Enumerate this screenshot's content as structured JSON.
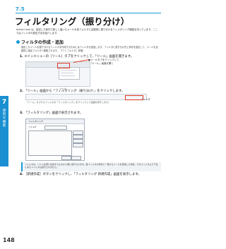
{
  "section": {
    "number": "7.5",
    "title": "フィルタリング（振り分け）"
  },
  "intro": "Active! mail は、指定した条件で新しく届いたメールを各フォルダに自動的に振り分けるフィルタリング機能を持っています。ここではフィルタの設定方法を紹介します。",
  "heading": "フィルタの作成・追加",
  "heading_note": "指定したメールを振り分けるフィルタを作成するためにはフィルタを追加します。フィルタに振り分け先と条件を設定して、メールを自動的に指定フォルダへ移動させます。（「7.1 フォルダ」参照）",
  "side_tab": {
    "number": "7",
    "label": "便利な機能"
  },
  "steps": [
    {
      "num": "1.",
      "text": "メインメニューの［ツール］タブをクリックして、「ツール」画面を開きます。"
    },
    {
      "num": "2.",
      "text": "「ツール」画面から「フィルタリング（振り分け）」をクリックします。"
    },
    {
      "num": "3.",
      "text": "「フィルタリング」画面が表示されます。"
    },
    {
      "num": "4.",
      "text": "［新規作成］ボタンをクリックし、「フィルタリング 新規作成」画面を表示します。"
    }
  ],
  "callouts": {
    "tools_tab": "●ツールタブをクリックして\n　「ツール」画面を開く",
    "tools_label": "ツール",
    "filter_label": "フィルタ"
  },
  "step2_note": "「ツール」タブからフィルタの「フィルタリング」をクリックして画面を表示します。",
  "dialog": {
    "title": "フィルタリング",
    "label": "フォルダ"
  },
  "info": "フィルタは、リスト先頭に位置するものから順に実行されます。各フィルタの条件に一致するメールを受信した場合、そのフィルタより下位にあるフィルタは実行されません。",
  "page_number": "148"
}
